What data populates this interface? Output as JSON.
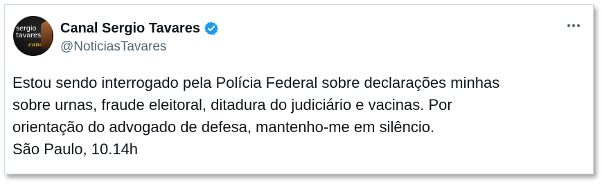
{
  "author": {
    "display_name": "Canal Sergio Tavares",
    "handle": "@NoticiasTavares",
    "verified": true,
    "avatar_lines": [
      "sergio",
      "tavares"
    ],
    "avatar_tag": "canal"
  },
  "menu": {
    "icon": "more-horizontal-icon"
  },
  "tweet": {
    "lines": [
      "Estou sendo interrogado pela Polícia Federal sobre declarações minhas",
      "sobre urnas, fraude eleitoral, ditadura do judiciário e vacinas. Por",
      "orientação do advogado de defesa, mantenho-me em silêncio.",
      "São Paulo,  10.14h"
    ]
  },
  "colors": {
    "verified_badge": "#1d9bf0",
    "handle": "#536471",
    "text": "#0f1419"
  }
}
